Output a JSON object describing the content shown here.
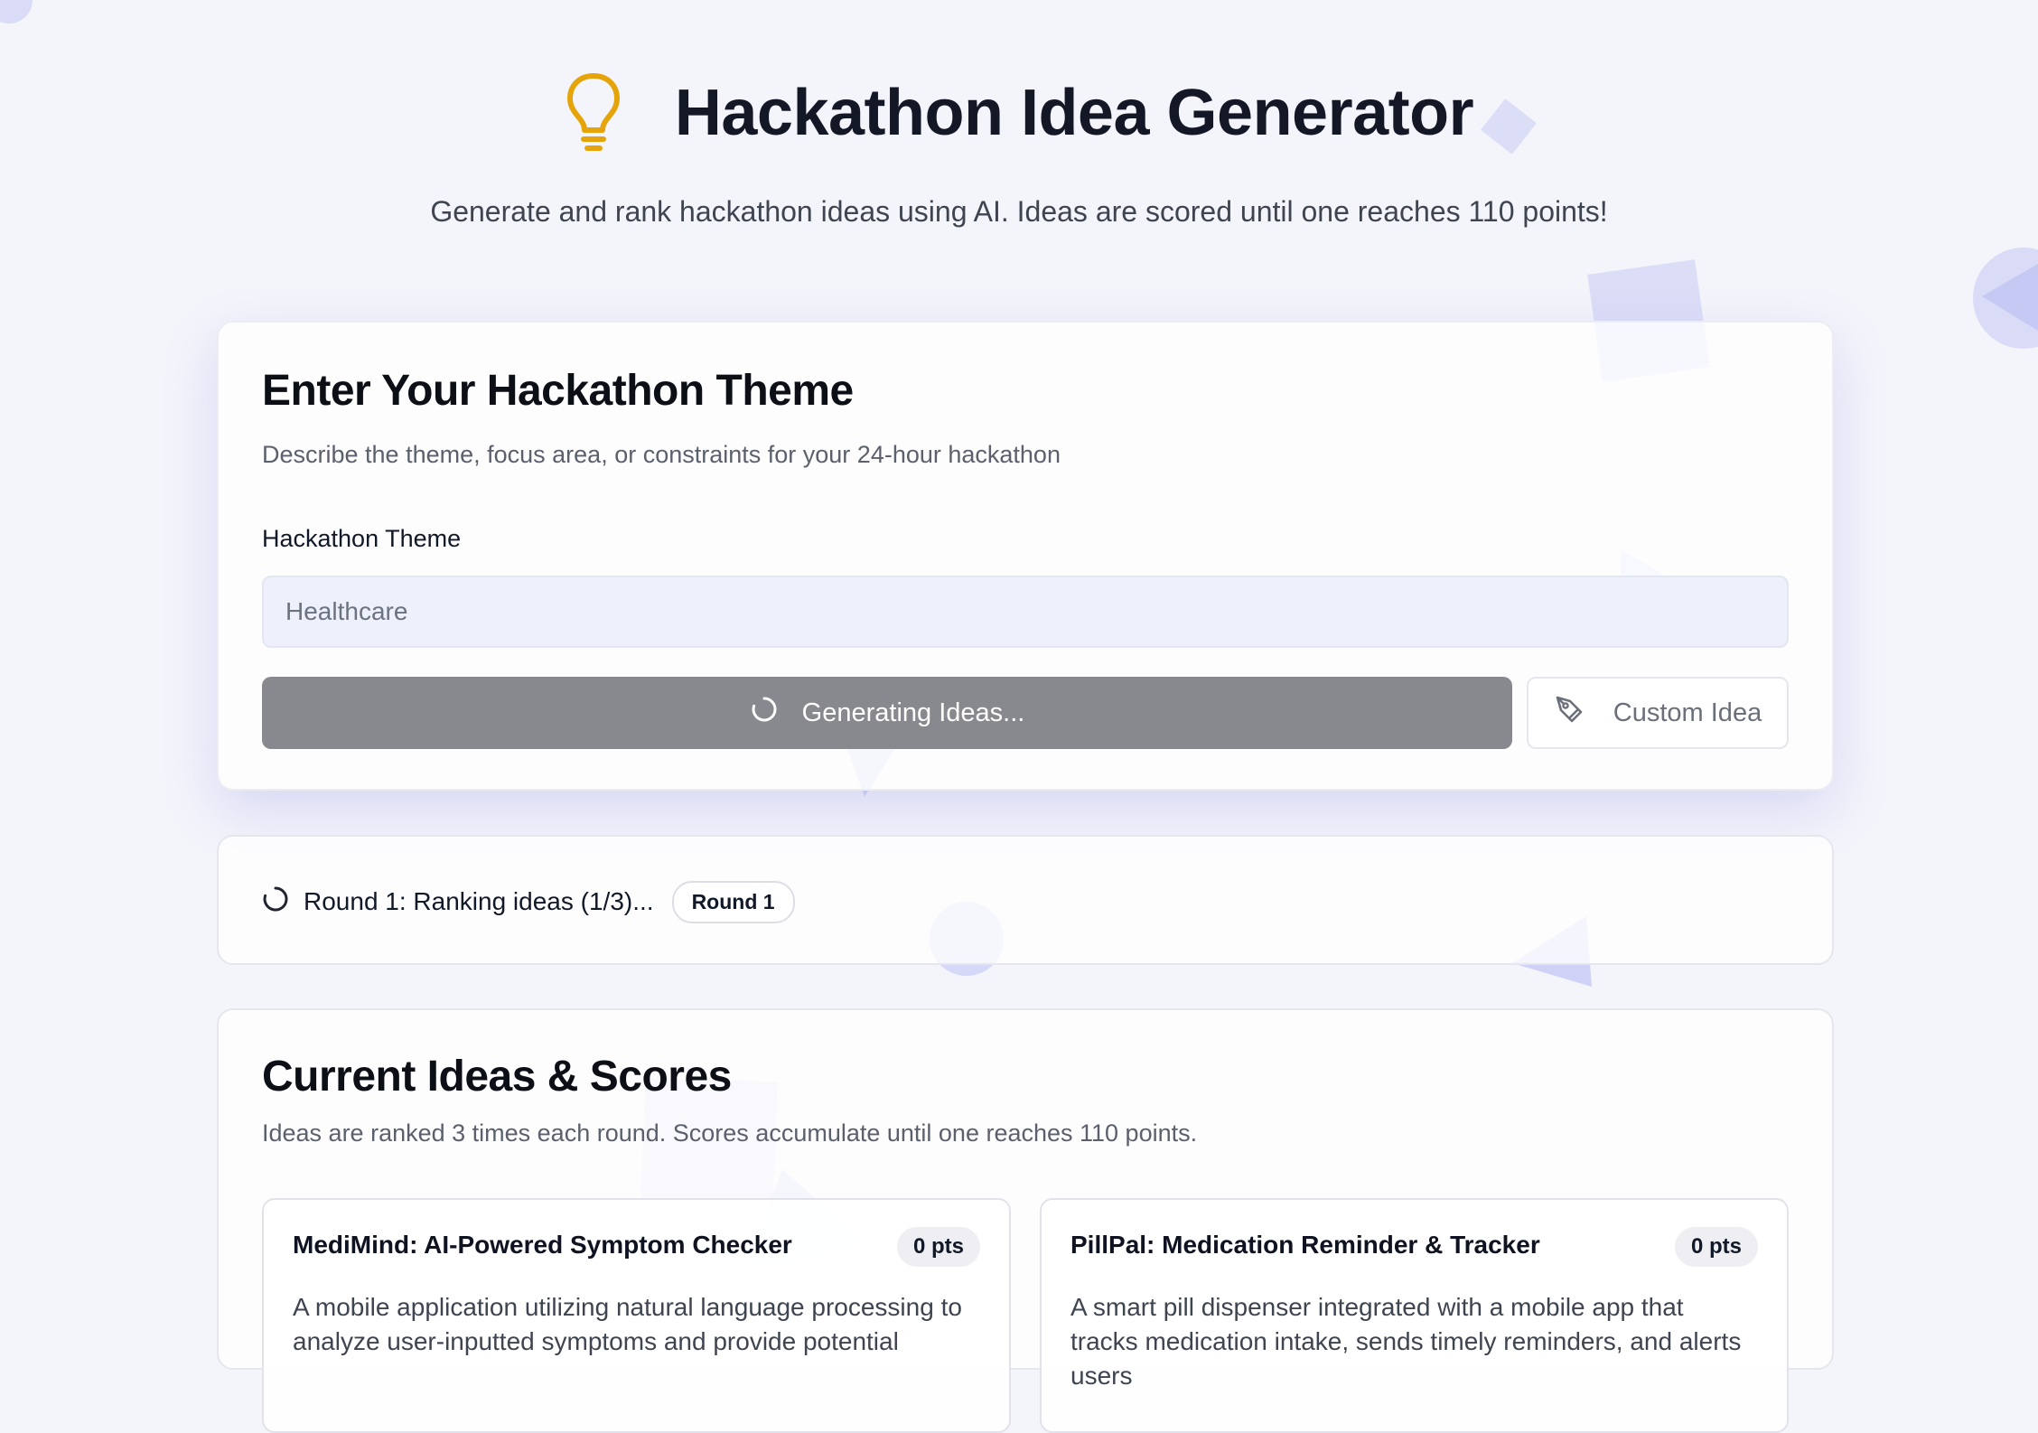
{
  "header": {
    "title": "Hackathon Idea Generator",
    "subtitle": "Generate and rank hackathon ideas using AI. Ideas are scored until one reaches 110 points!",
    "icon": "lightbulb-icon",
    "icon_color": "#e5a50a"
  },
  "theme_card": {
    "heading": "Enter Your Hackathon Theme",
    "description": "Describe the theme, focus area, or constraints for your 24-hour hackathon",
    "field_label": "Hackathon Theme",
    "input_placeholder": "Healthcare",
    "input_value": "",
    "generate_button_label": "Generating Ideas...",
    "custom_button_label": "Custom Idea"
  },
  "status": {
    "text": "Round 1: Ranking ideas (1/3)...",
    "round_badge": "Round 1"
  },
  "ideas": {
    "heading": "Current Ideas & Scores",
    "description": "Ideas are ranked 3 times each round. Scores accumulate until one reaches 110 points.",
    "items": [
      {
        "title": "MediMind: AI-Powered Symptom Checker",
        "points": "0 pts",
        "description": "A mobile application utilizing natural language processing to analyze user-inputted symptoms and provide potential"
      },
      {
        "title": "PillPal: Medication Reminder & Tracker",
        "points": "0 pts",
        "description": "A smart pill dispenser integrated with a mobile app that tracks medication intake, sends timely reminders, and alerts users"
      }
    ]
  },
  "colors": {
    "background": "#f4f4fb",
    "accent_shapes": "#6b7bea",
    "generate_button": "#88898f"
  }
}
